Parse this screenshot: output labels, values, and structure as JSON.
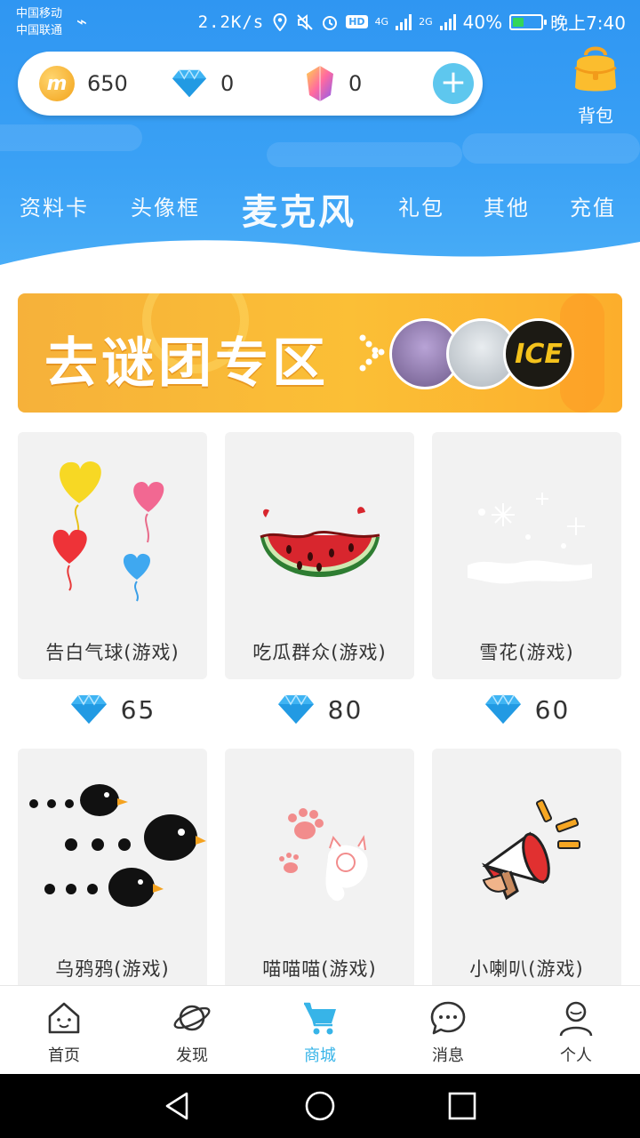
{
  "status_bar": {
    "carrier1": "中国移动",
    "carrier2": "中国联通",
    "speed": "2.2K/s",
    "hd": "HD",
    "net1": "4G",
    "net2": "2G",
    "battery": "40%",
    "battery_level": 0.4,
    "time": "晚上7:40"
  },
  "wallet": {
    "coins": "650",
    "coin_symbol": "m",
    "diamonds": "0",
    "crystals": "0"
  },
  "backpack_label": "背包",
  "tabs": [
    {
      "label": "资料卡"
    },
    {
      "label": "头像框"
    },
    {
      "label": "麦克风",
      "active": true
    },
    {
      "label": "礼包"
    },
    {
      "label": "其他"
    },
    {
      "label": "充值"
    }
  ],
  "banner": {
    "title": "去谜团专区",
    "badge_text": "ICE"
  },
  "items": [
    {
      "name": "告白气球(游戏)",
      "price": "65"
    },
    {
      "name": "吃瓜群众(游戏)",
      "price": "80"
    },
    {
      "name": "雪花(游戏)",
      "price": "60"
    },
    {
      "name": "乌鸦鸦(游戏)"
    },
    {
      "name": "喵喵喵(游戏)"
    },
    {
      "name": "小喇叭(游戏)"
    }
  ],
  "bottom_nav": [
    {
      "label": "首页",
      "icon": "home-icon"
    },
    {
      "label": "发现",
      "icon": "planet-icon"
    },
    {
      "label": "商城",
      "icon": "cart-icon",
      "active": true
    },
    {
      "label": "消息",
      "icon": "message-icon"
    },
    {
      "label": "个人",
      "icon": "person-icon"
    }
  ],
  "colors": {
    "header_blue": "#2f96f2",
    "active_nav": "#37b4e8",
    "banner_orange": "#fbbf36",
    "diamond": "#3fb4f3"
  }
}
